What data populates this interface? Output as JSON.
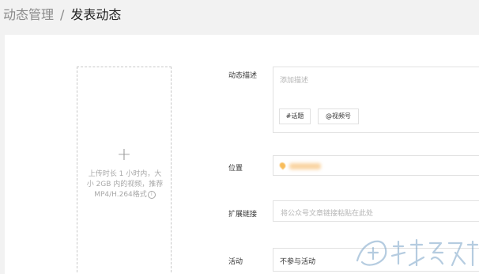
{
  "breadcrumb": {
    "parent": "动态管理",
    "separator": "/",
    "current": "发表动态"
  },
  "upload": {
    "plus": "+",
    "hint": "上传时长 1 小时内，大小 2GB 内的视频，推荐MP4/H.264格式",
    "info_icon": "info-icon"
  },
  "form": {
    "description": {
      "label": "动态描述",
      "placeholder": "添加描述",
      "topic_button": "#话题",
      "channel_button": "@视频号"
    },
    "location": {
      "label": "位置",
      "icon": "location-icon"
    },
    "extended_link": {
      "label": "扩展链接",
      "placeholder": "将公众号文章链接粘贴在此处"
    },
    "activity": {
      "label": "活动",
      "value": "不参与活动"
    }
  },
  "colors": {
    "background": "#f2f2f2",
    "card": "#ffffff",
    "border": "#e2e2e2",
    "placeholder": "#b4b4b4",
    "location_accent": "#f6a623"
  }
}
